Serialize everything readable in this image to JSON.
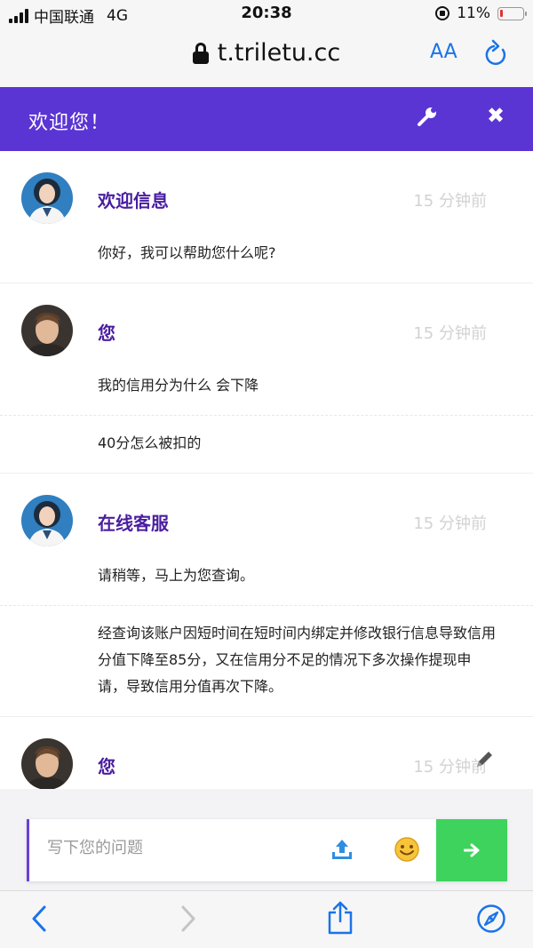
{
  "status_bar": {
    "carrier": "中国联通",
    "network": "4G",
    "time": "20:38",
    "battery": "11%",
    "battery_level": 0.11,
    "battery_color": "#e5312f"
  },
  "browser": {
    "url": "t.triletu.cc",
    "text_size_label": "AA"
  },
  "chat_header": {
    "title": "欢迎您！",
    "accent_color": "#5b34d4"
  },
  "messages": [
    {
      "sender": "欢迎信息",
      "time": "15 分钟前",
      "avatar": "female-agent",
      "texts": [
        "你好，我可以帮助您什么呢?"
      ]
    },
    {
      "sender": "您",
      "time": "15 分钟前",
      "avatar": "male-user",
      "texts": [
        "我的信用分为什么 会下降",
        "40分怎么被扣的"
      ]
    },
    {
      "sender": "在线客服",
      "time": "15 分钟前",
      "avatar": "female-agent",
      "texts": [
        "请稍等，马上为您查询。",
        "经查询该账户因短时间在短时间内绑定并修改银行信息导致信用分值下降至85分，又在信用分不足的情况下多次操作提现申请，导致信用分值再次下降。"
      ]
    },
    {
      "sender": "您",
      "time": "15 分钟前",
      "avatar": "male-user",
      "texts": []
    }
  ],
  "composer": {
    "placeholder": "写下您的问题",
    "send_color": "#3dd35c"
  }
}
